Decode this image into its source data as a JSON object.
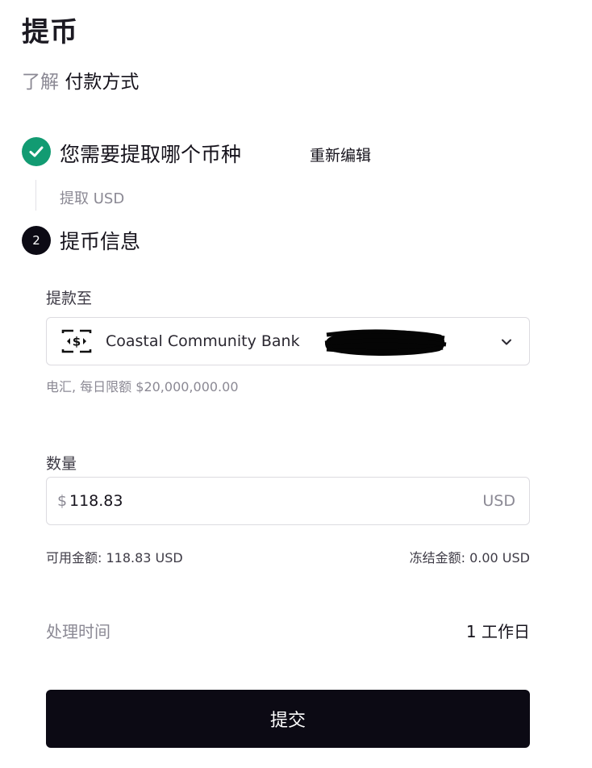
{
  "page": {
    "title": "提币",
    "learn_prefix": "了解",
    "learn_link": "付款方式"
  },
  "steps": [
    {
      "icon": "check-icon",
      "icon_color": "#129b72",
      "title": "您需要提取哪个币种",
      "action_label": "重新编辑",
      "summary": "提取 USD"
    },
    {
      "number": "2",
      "icon_color": "#0c0a14",
      "title": "提币信息"
    }
  ],
  "form": {
    "destination_label": "提款至",
    "destination": {
      "icon": "bank-transfer-icon",
      "bank_name": "Coastal Community Bank",
      "hint": "电汇, 每日限额 $20,000,000.00"
    },
    "amount_label": "数量",
    "amount": {
      "currency_symbol": "$",
      "value": "118.83",
      "unit": "USD"
    },
    "available_balance": "可用金额: 118.83 USD",
    "frozen_balance": "冻结金额: 0.00 USD",
    "processing_time_label": "处理时间",
    "processing_time_value": "1 工作日",
    "submit_label": "提交"
  },
  "colors": {
    "accent_dark": "#0c0a14",
    "success_green": "#129b72",
    "muted_text": "#8b8994"
  }
}
